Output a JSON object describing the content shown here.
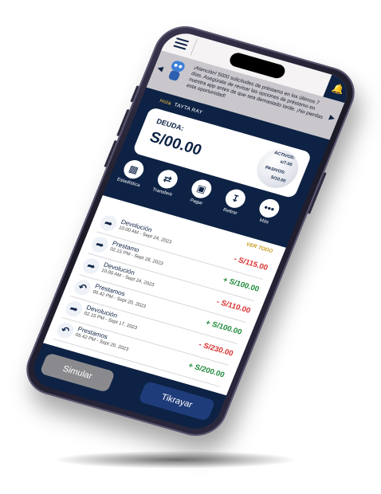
{
  "topbar": {
    "menu_icon": "hamburger-menu-icon",
    "bell_icon": "bell-icon"
  },
  "notice": {
    "text": "¡Atención! 5000 solicitudes de préstamo en los últimos 7 días. Asegúrate de revisar las opciones de préstamo en nuestra app antes de que sea demasiado tarde. ¡No pierdas esta oportunidad!"
  },
  "greeting": {
    "hola": "Hola",
    "name": "TAYTA RAY"
  },
  "debt_card": {
    "label": "DEUDA:",
    "amount": "S/00.00",
    "assets_label": "ACTIVOS:",
    "assets_value": "s/7.00",
    "liabilities_label": "PASIVOS:",
    "liabilities_value": "S/10.00"
  },
  "actions": [
    {
      "label": "Estadística",
      "icon": "bar-chart-icon"
    },
    {
      "label": "Transferir",
      "icon": "transfer-icon"
    },
    {
      "label": "Pagar",
      "icon": "scan-qr-icon"
    },
    {
      "label": "Retirar",
      "icon": "withdraw-icon"
    },
    {
      "label": "Más",
      "icon": "more-dots-icon"
    }
  ],
  "list": {
    "ver_todo": "VER TODO",
    "transactions": [
      {
        "title": "Devolución",
        "date": "10.00 AM - Sept 24, 2023",
        "amount": "- S/115.00",
        "type": "negative",
        "icon": "arrow-forward-icon"
      },
      {
        "title": "Prestamo",
        "date": "02.15 PM - Sept 28, 2023",
        "amount": "+ S/100.00",
        "type": "positive",
        "icon": "arrow-forward-icon"
      },
      {
        "title": "Devolución",
        "date": "10.00 AM - Sept 24, 2023",
        "amount": "- S/110.00",
        "type": "negative",
        "icon": "arrow-forward-icon"
      },
      {
        "title": "Prestamos",
        "date": "05.42 PM - Sept 20, 2023",
        "amount": "+ S/100.00",
        "type": "positive",
        "icon": "arrow-back-icon"
      },
      {
        "title": "Devolución",
        "date": "02.15 PM - Sept 17, 2023",
        "amount": "- S/230.00",
        "type": "negative",
        "icon": "arrow-forward-icon"
      },
      {
        "title": "Prestamos",
        "date": "05.42 PM - Sept 20, 2023",
        "amount": "+ S/200.00",
        "type": "positive",
        "icon": "arrow-back-icon"
      }
    ]
  },
  "buttons": {
    "simular": "Simular",
    "tikrayar": "Tikrayar"
  },
  "colors": {
    "navy": "#0d2244",
    "negative": "#d93030",
    "positive": "#1f8a3a",
    "accent": "#c79a1a"
  }
}
